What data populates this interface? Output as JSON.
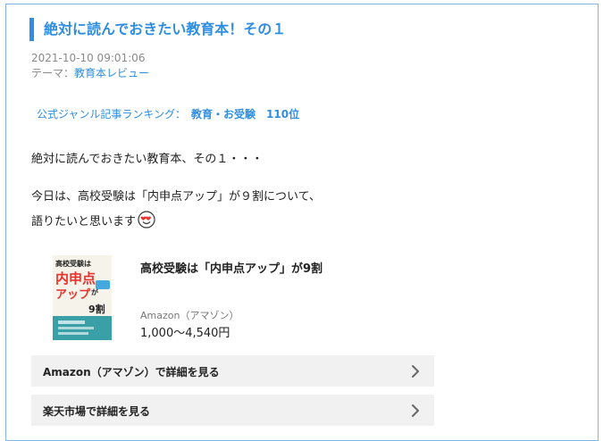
{
  "article": {
    "title": "絶対に読んでおきたい教育本！その１",
    "date": "2021-10-10 09:01:06",
    "theme_prefix": "テーマ：",
    "theme_link": "教育本レビュー",
    "ranking_label": "公式ジャンル記事ランキング：",
    "ranking_value": "教育・お受験　110位",
    "paragraph1": "絶対に読んでおきたい教育本、その１・・・",
    "paragraph2": "今日は、高校受験は「内申点アップ」が９割について、",
    "paragraph3": "語りたいと思います",
    "emoji_icon": "heart-eyes-emoji-icon"
  },
  "product": {
    "title": "高校受験は「内申点アップ」が9割",
    "store": "Amazon（アマゾン）",
    "price": "1,000〜4,540円",
    "cover": {
      "line1": "高校受験は",
      "line2": "内申点",
      "line3": "アップ",
      "line4": "が",
      "line5": "9割",
      "accent": "#e8322c"
    }
  },
  "buttons": [
    {
      "label": "Amazon（アマゾン）で詳細を見る",
      "icon": "chevron-right-icon"
    },
    {
      "label": "楽天市場で詳細を見る",
      "icon": "chevron-right-icon"
    }
  ],
  "colors": {
    "accent": "#2f8ee0",
    "border": "#7fb6e6",
    "button_bg": "#f1f1f1"
  }
}
